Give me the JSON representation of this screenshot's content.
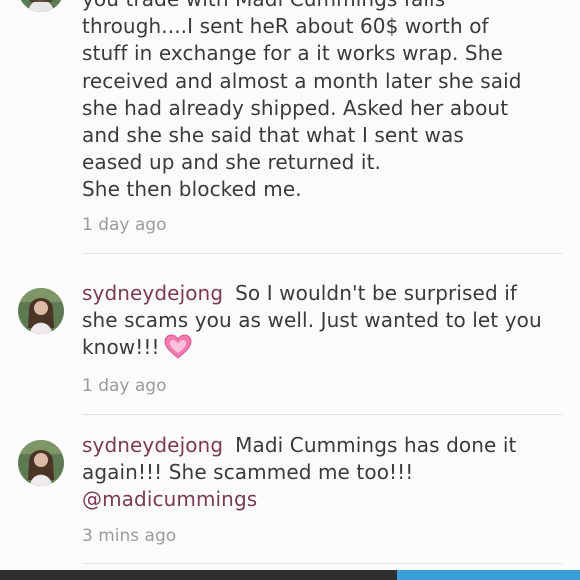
{
  "comments": [
    {
      "username": "",
      "lines": [
        "you trade with Madi Cummings fails",
        "through....I sent heR about 60$ worth of",
        "stuff in exchange for a it works wrap. She",
        "received and almost a month later she said",
        "she had already shipped. Asked her about",
        "and she she said that  what I sent was",
        "eased up and she returned it.",
        "She then blocked me."
      ],
      "time": "1 day ago"
    },
    {
      "username": "sydneydejong",
      "text": "So I wouldn't be surprised if she scams you as well. Just wanted to let you know!!!",
      "emoji": "heart-emoji",
      "time": "1 day ago"
    },
    {
      "username": "sydneydejong",
      "text": "Madi Cummings has done it again!!! She scammed me too!!!",
      "mention": "@madicummings",
      "time": "3 mins ago"
    }
  ],
  "colors": {
    "username": "#7b3a54",
    "text": "#3a3a3a",
    "timestamp": "#9b9b9b",
    "divider": "#e3e1e2",
    "bottom_left": "#2f2f2f",
    "bottom_right": "#3a9fd8"
  }
}
